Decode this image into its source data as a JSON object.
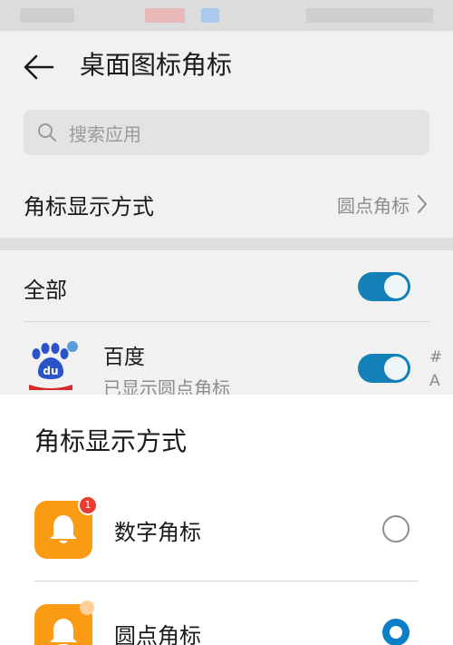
{
  "header": {
    "title": "桌面图标角标"
  },
  "search": {
    "placeholder": "搜索应用"
  },
  "badge_style_row": {
    "label": "角标显示方式",
    "value": "圆点角标"
  },
  "all_row": {
    "label": "全部",
    "enabled": true
  },
  "app_list": [
    {
      "name": "百度",
      "subtitle": "已显示圆点角标",
      "enabled": true,
      "icon": "baidu-app-icon"
    }
  ],
  "index_bar": [
    "#",
    "A"
  ],
  "sheet": {
    "title": "角标显示方式",
    "options": [
      {
        "label": "数字角标",
        "selected": false,
        "badge": "1",
        "icon": "bell-icon"
      },
      {
        "label": "圆点角标",
        "selected": true,
        "icon": "bell-icon"
      }
    ]
  },
  "colors": {
    "accent": "#1380b7",
    "icon_orange": "#fb9a13",
    "badge_red": "#e83b32",
    "sheet_bg": "#ffffff"
  }
}
